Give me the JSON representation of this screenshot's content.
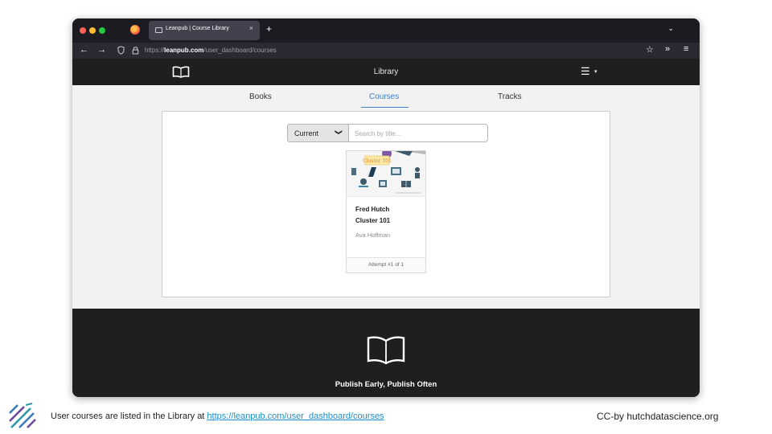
{
  "browser": {
    "tab_title": "Leanpub | Course Library",
    "tab_close": "×",
    "new_tab": "+",
    "tab_list": "⌄",
    "url_prefix": "https://",
    "url_domain": "leanpub.com",
    "url_path": "/user_dashboard/courses",
    "nav": {
      "back": "←",
      "forward": "→",
      "bookmark": "☆",
      "more": "»",
      "menu": "≡"
    }
  },
  "site_header": {
    "title": "Library",
    "menu_icon": "☰",
    "menu_caret": "▾"
  },
  "library_tabs": [
    {
      "label": "Books",
      "active": false
    },
    {
      "label": "Courses",
      "active": true
    },
    {
      "label": "Tracks",
      "active": false
    }
  ],
  "filter": {
    "selected": "Current",
    "chevron": "❯",
    "search_placeholder": "Search by title..."
  },
  "course": {
    "cover_label": "Cluster 101",
    "title_line1": "Fred Hutch",
    "title_line2": "Cluster 101",
    "author": "Ava Hoffman",
    "attempt": "Attempt #1 of 1"
  },
  "site_footer": {
    "slogan": "Publish Early, Publish Often"
  },
  "slide": {
    "caption_text": "User courses are listed in the Library at ",
    "caption_link": "https://leanpub.com/user_dashboard/courses",
    "credit": "CC-by hutchdatascience.org"
  },
  "colors": {
    "accent": "#3f7fc7",
    "header_bg": "#1f1f1f",
    "link": "#1b8fc7"
  }
}
